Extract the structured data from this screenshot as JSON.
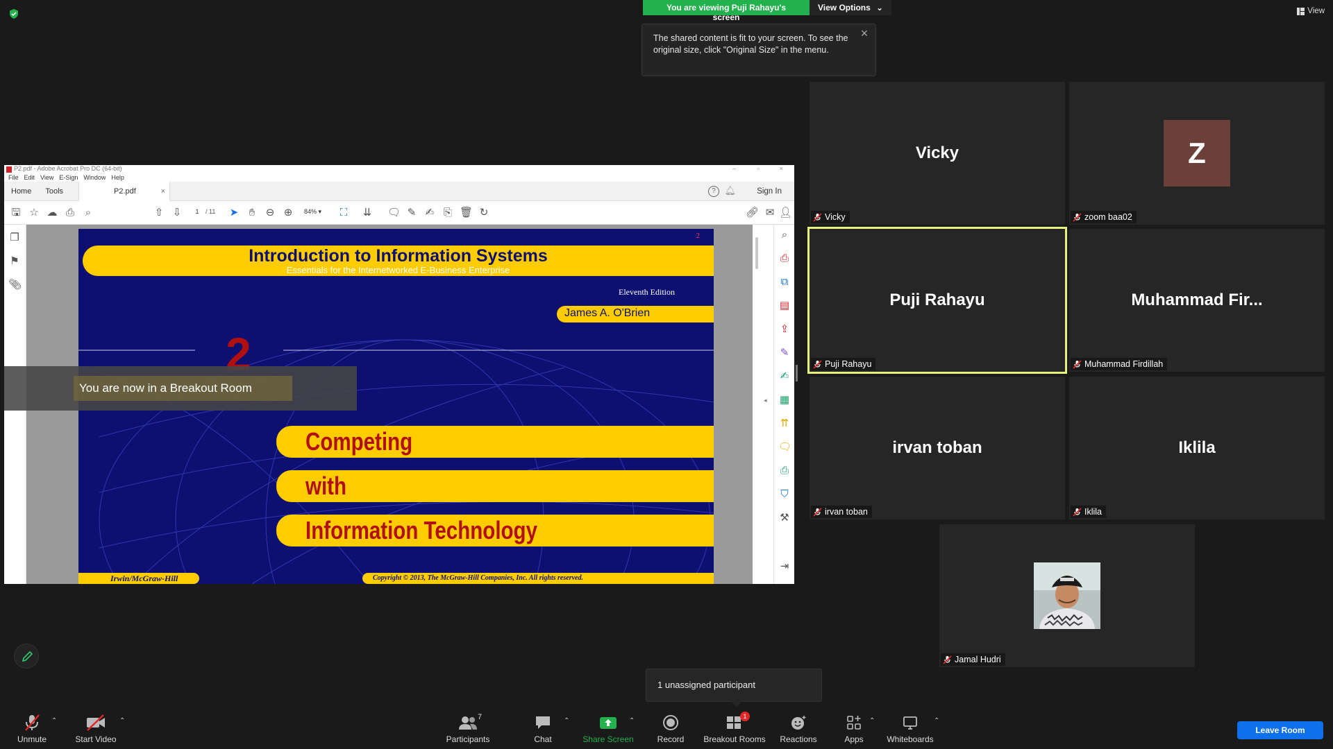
{
  "top": {
    "viewing_text": "You are viewing Puji Rahayu's screen",
    "view_options": "View Options",
    "tooltip": "The shared content is fit to your screen. To see the original size, click \"Original Size\" in the menu.",
    "view_label": "View"
  },
  "gallery": {
    "tiles": [
      {
        "name": "Vicky",
        "label": "Vicky"
      },
      {
        "name": "Z",
        "label": "zoom baa02"
      },
      {
        "name": "Puji Rahayu",
        "label": "Puji Rahayu"
      },
      {
        "name": "Muhammad  Fir...",
        "label": "Muhammad Firdillah"
      },
      {
        "name": "irvan toban",
        "label": "irvan toban"
      },
      {
        "name": "Iklila",
        "label": "Iklila"
      },
      {
        "name": "",
        "label": "Jamal Hudri"
      }
    ]
  },
  "acrobat": {
    "title": "P2.pdf - Adobe Acrobat Pro DC (64-bit)",
    "menu": [
      "File",
      "Edit",
      "View",
      "E-Sign",
      "Window",
      "Help"
    ],
    "tab_home": "Home",
    "tab_tools": "Tools",
    "doc_tab": "P2.pdf",
    "sign_in": "Sign In",
    "page_current": "1",
    "page_total": "/ 11",
    "zoom": "84%"
  },
  "slide": {
    "page_num": "2",
    "title": "Introduction to Information Systems",
    "subtitle": "Essentials for the Internetworked E-Business Enterprise",
    "edition": "Eleventh Edition",
    "author": "James A. O'Brien",
    "chapter": "2",
    "line1": "Competing",
    "line2": "with",
    "line3": "Information Technology",
    "publisher": "Irwin/McGraw-Hill",
    "copyright": "Copyright © 2013, The McGraw-Hill Companies, Inc. All rights reserved."
  },
  "breakout_toast": "You are now in a Breakout Room",
  "unassigned": "1 unassigned participant",
  "toolbar": {
    "unmute": "Unmute",
    "start_video": "Start Video",
    "participants": "Participants",
    "participants_count": "7",
    "chat": "Chat",
    "share_screen": "Share Screen",
    "record": "Record",
    "breakout_rooms": "Breakout Rooms",
    "breakout_badge": "1",
    "reactions": "Reactions",
    "apps": "Apps",
    "whiteboards": "Whiteboards",
    "leave": "Leave Room"
  },
  "colors": {
    "share_green": "#22b14c",
    "active_speaker": "#e8f27a",
    "leave_blue": "#0e71eb",
    "slide_navy": "#0d1070",
    "slide_yellow": "#ffcc00",
    "slide_red": "#b01010"
  }
}
